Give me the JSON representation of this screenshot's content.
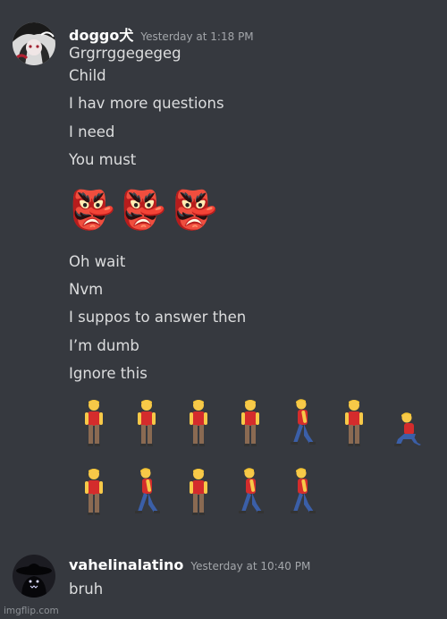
{
  "messages": [
    {
      "author": "doggo犬",
      "timestamp": "Yesterday at 1:18 PM",
      "avatar": "doggo-avatar",
      "lines": [
        "Grgrrggegegeg",
        "Child",
        "I hav more questions",
        "I need",
        "You must"
      ],
      "emoji_big": [
        "👺",
        "👺",
        "👺"
      ],
      "lines_after": [
        "Oh wait",
        "Nvm",
        "I suppos to answer then",
        "I’m dumb",
        "Ignore this"
      ],
      "emoji_rows": [
        [
          "standing-man-icon",
          "standing-man-icon",
          "standing-man-icon",
          "standing-man-icon",
          "walking-man-icon",
          "standing-man-icon",
          "kneeling-man-icon"
        ],
        [
          "standing-man-icon",
          "walking-man-icon",
          "standing-man-icon",
          "walking-man-icon",
          "walking-man-icon"
        ]
      ]
    },
    {
      "author": "vahelinalatino",
      "timestamp": "Yesterday at 10:40 PM",
      "avatar": "vahelinalatino-avatar",
      "lines": [
        "bruh"
      ]
    }
  ],
  "watermark": "imgflip.com",
  "colors": {
    "background": "#36393f",
    "username": "#ffffff",
    "text": "#dcddde",
    "timestamp": "#a3a6aa",
    "shirt": "#d42c2c",
    "pants": "#8a6a52",
    "walk_pants": "#3b5fa8",
    "hair": "#f2c230",
    "skin": "#f7c948"
  }
}
